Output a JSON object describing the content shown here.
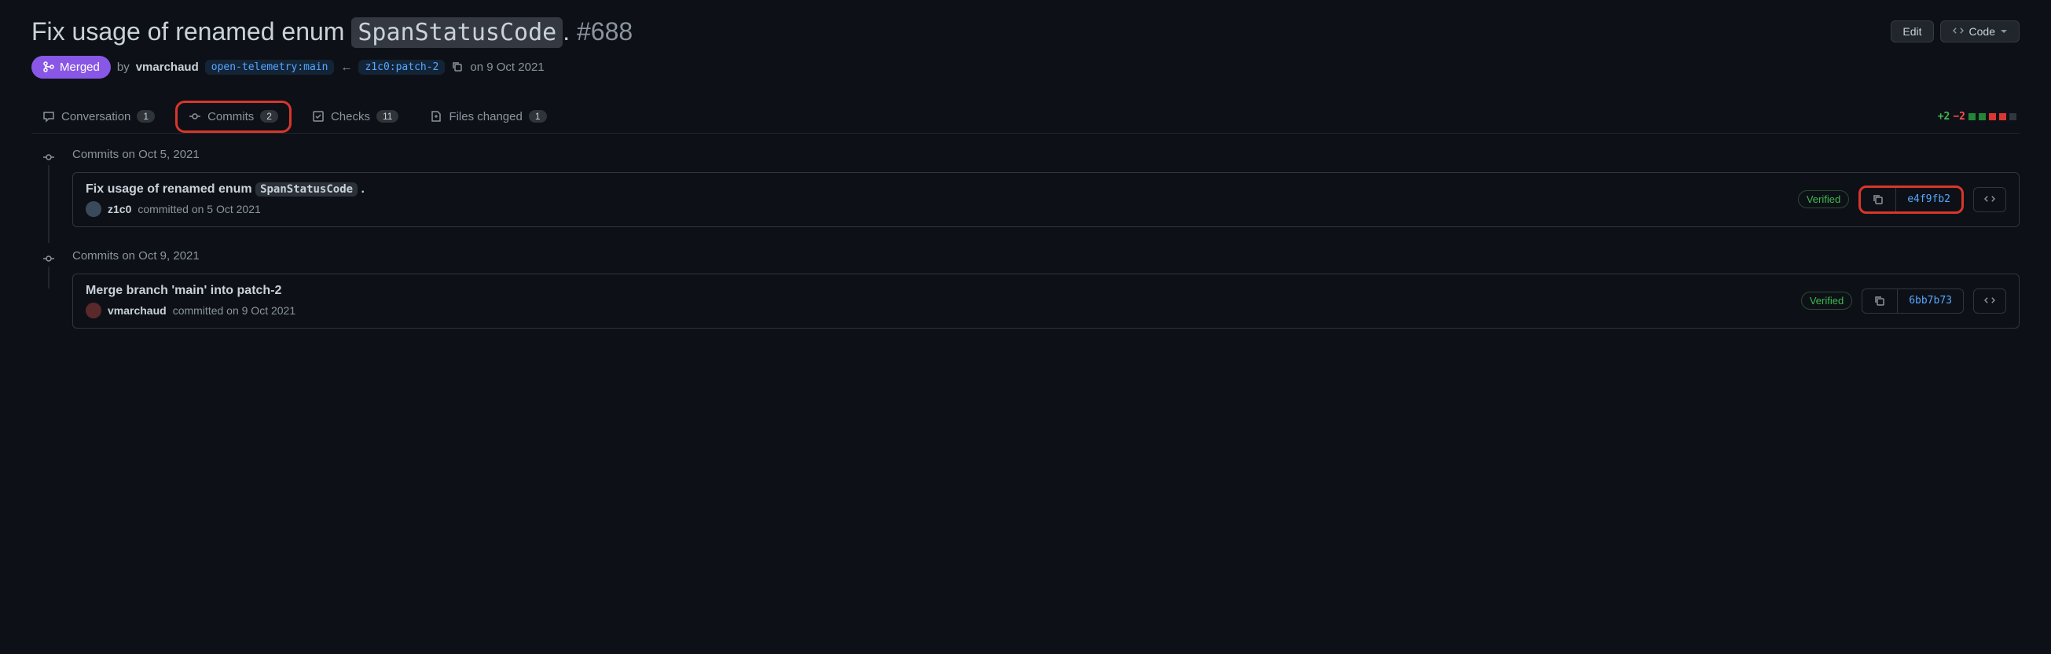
{
  "header": {
    "title_prefix": "Fix usage of renamed enum ",
    "title_code": "SpanStatusCode",
    "title_suffix": ".",
    "issue_number": "#688",
    "edit_label": "Edit",
    "code_label": "Code"
  },
  "meta": {
    "status": "Merged",
    "by_label": "by",
    "author": "vmarchaud",
    "base_branch": "open-telemetry:main",
    "head_branch": "z1c0:patch-2",
    "date": "on 9 Oct 2021"
  },
  "tabs": {
    "conversation": {
      "label": "Conversation",
      "count": "1"
    },
    "commits": {
      "label": "Commits",
      "count": "2"
    },
    "checks": {
      "label": "Checks",
      "count": "11"
    },
    "files": {
      "label": "Files changed",
      "count": "1"
    }
  },
  "diff": {
    "additions": "+2",
    "deletions": "−2"
  },
  "groups": [
    {
      "date_label": "Commits on Oct 5, 2021",
      "commit": {
        "title_prefix": "Fix usage of renamed enum ",
        "title_code": "SpanStatusCode",
        "title_suffix": " .",
        "author": "z1c0",
        "committed_text": "committed on 5 Oct 2021",
        "verified": "Verified",
        "sha": "e4f9fb2",
        "highlight_sha": true
      }
    },
    {
      "date_label": "Commits on Oct 9, 2021",
      "commit": {
        "title_prefix": "Merge branch 'main' into patch-2",
        "title_code": "",
        "title_suffix": "",
        "author": "vmarchaud",
        "committed_text": "committed on 9 Oct 2021",
        "verified": "Verified",
        "sha": "6bb7b73",
        "highlight_sha": false
      }
    }
  ]
}
